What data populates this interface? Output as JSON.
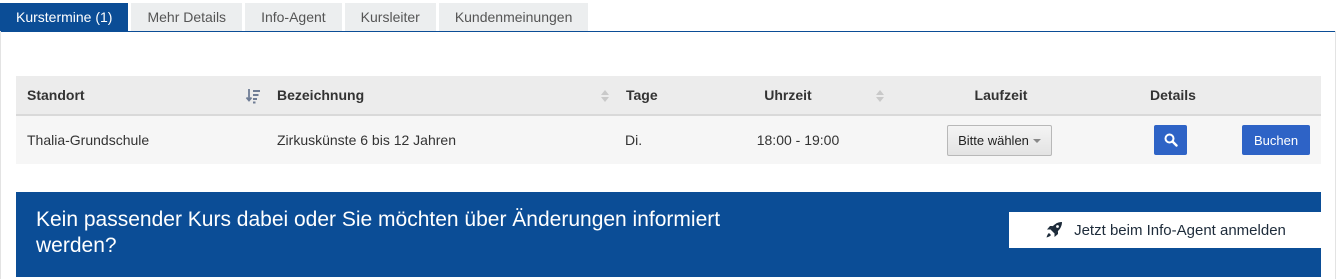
{
  "tabs": [
    {
      "label": "Kurstermine (1)",
      "active": true
    },
    {
      "label": "Mehr Details"
    },
    {
      "label": "Info-Agent"
    },
    {
      "label": "Kursleiter"
    },
    {
      "label": "Kundenmeinungen"
    }
  ],
  "table": {
    "headers": {
      "standort": "Standort",
      "bezeichnung": "Bezeichnung",
      "tage": "Tage",
      "uhrzeit": "Uhrzeit",
      "laufzeit": "Laufzeit",
      "details": "Details"
    },
    "rows": [
      {
        "standort": "Thalia-Grundschule",
        "bezeichnung": "Zirkuskünste 6 bis 12 Jahren",
        "tage": "Di.",
        "uhrzeit": "18:00 - 19:00",
        "laufzeit_select": "Bitte wählen",
        "book_label": "Buchen"
      }
    ]
  },
  "banner": {
    "text": "Kein passender Kurs dabei oder Sie möchten über Änderungen informiert werden?",
    "button_label": "Jetzt beim Info-Agent anmelden"
  },
  "colors": {
    "primary": "#0b4d96",
    "button_blue": "#2e63c6"
  },
  "icons": {
    "sort_active": "sort-amount-icon",
    "sort": "sort-updown-icon",
    "search": "search-icon",
    "rocket": "rocket-icon",
    "caret": "caret-down-icon"
  }
}
